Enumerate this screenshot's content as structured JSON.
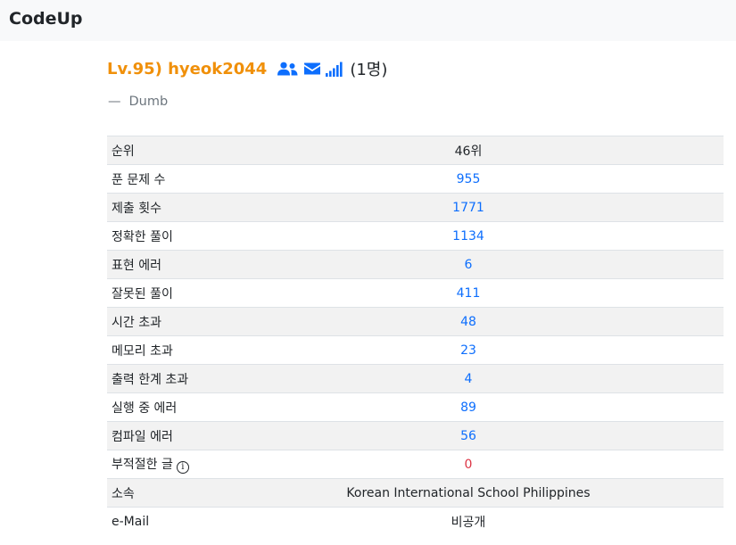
{
  "navbar": {
    "brand": "CodeUp"
  },
  "profile": {
    "username_display": "Lv.95) hyeok2044",
    "icons": [
      "users-icon",
      "envelope-icon",
      "signal-bars-icon"
    ],
    "followers": "(1명)",
    "motto_dash": "—",
    "motto": "Dumb",
    "colors": {
      "username": "#f0900a",
      "link": "#0d6efd",
      "zero": "#dc3545"
    }
  },
  "stats": [
    {
      "label": "순위",
      "value": "46위"
    },
    {
      "label": "푼 문제 수",
      "value": "955"
    },
    {
      "label": "제출 횟수",
      "value": "1771"
    },
    {
      "label": "정확한 풀이",
      "value": "1134"
    },
    {
      "label": "표현 에러",
      "value": "6"
    },
    {
      "label": "잘못된 풀이",
      "value": "411"
    },
    {
      "label": "시간 초과",
      "value": "48"
    },
    {
      "label": "메모리 초과",
      "value": "23"
    },
    {
      "label": "출력 한계 초과",
      "value": "4"
    },
    {
      "label": "실행 중 에러",
      "value": "89"
    },
    {
      "label": "컴파일 에러",
      "value": "56"
    },
    {
      "label": "부적절한 글",
      "value": "0",
      "info_icon": "i"
    },
    {
      "label": "소속",
      "value": "Korean International School Philippines"
    },
    {
      "label": "e-Mail",
      "value": "비공개"
    }
  ]
}
